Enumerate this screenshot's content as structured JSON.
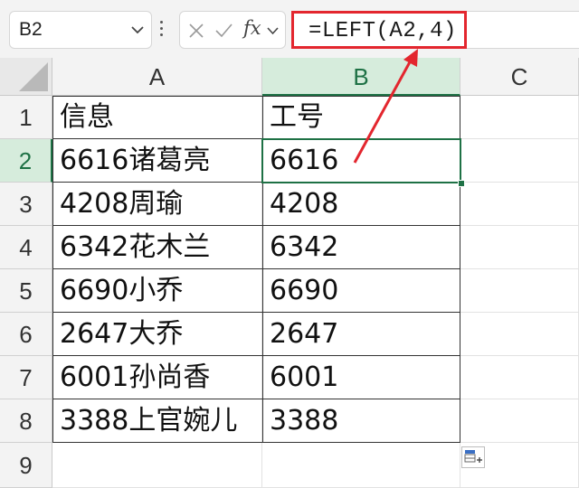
{
  "name_box": {
    "value": "B2"
  },
  "formula_bar": {
    "fx_label": "fx",
    "formula": "=LEFT(A2,4)"
  },
  "columns": [
    "A",
    "B",
    "C"
  ],
  "rows": [
    {
      "num": "1",
      "a": "信息",
      "b": "工号"
    },
    {
      "num": "2",
      "a": "6616诸葛亮",
      "b": "6616"
    },
    {
      "num": "3",
      "a": "4208周瑜",
      "b": "4208"
    },
    {
      "num": "4",
      "a": "6342花木兰",
      "b": "6342"
    },
    {
      "num": "5",
      "a": "6690小乔",
      "b": "6690"
    },
    {
      "num": "6",
      "a": "2647大乔",
      "b": "2647"
    },
    {
      "num": "7",
      "a": "6001孙尚香",
      "b": "6001"
    },
    {
      "num": "8",
      "a": "3388上官婉儿",
      "b": "3388"
    },
    {
      "num": "9",
      "a": "",
      "b": ""
    }
  ],
  "selection": {
    "cell": "B2"
  },
  "colors": {
    "highlight": "#e3262e",
    "selection": "#1e7145"
  },
  "icons": [
    "chevron-down-icon",
    "more-vertical-icon",
    "cancel-x-icon",
    "confirm-check-icon",
    "fx-icon",
    "paste-options-icon",
    "annotation-arrow"
  ]
}
